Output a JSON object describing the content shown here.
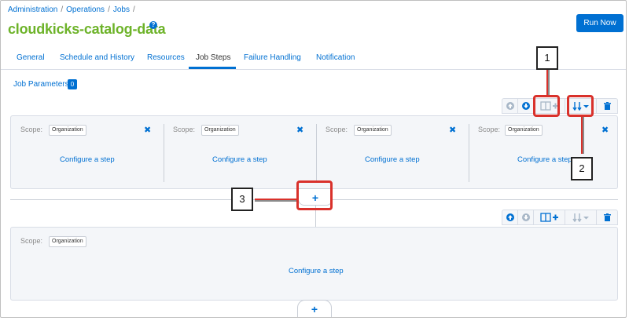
{
  "breadcrumb": [
    "Administration",
    "Operations",
    "Jobs"
  ],
  "breadcrumb_sep": "/",
  "page_title": "cloudkicks-catalog-data",
  "help_glyph": "?",
  "run_button": "Run Now",
  "tabs": [
    {
      "label": "General"
    },
    {
      "label": "Schedule and History"
    },
    {
      "label": "Resources"
    },
    {
      "label": "Job Steps",
      "active": true
    },
    {
      "label": "Failure Handling"
    },
    {
      "label": "Notification"
    }
  ],
  "job_parameters": {
    "label": "Job Parameters",
    "count": "0"
  },
  "flow1": {
    "steps": [
      {
        "scope_label": "Scope:",
        "scope_value": "Organization",
        "close": "✖",
        "configure": "Configure a step"
      },
      {
        "scope_label": "Scope:",
        "scope_value": "Organization",
        "close": "✖",
        "configure": "Configure a step"
      },
      {
        "scope_label": "Scope:",
        "scope_value": "Organization",
        "close": "✖",
        "configure": "Configure a step"
      },
      {
        "scope_label": "Scope:",
        "scope_value": "Organization",
        "close": "✖",
        "configure": "Configure a step"
      }
    ]
  },
  "flow2": {
    "steps": [
      {
        "scope_label": "Scope:",
        "scope_value": "Organization",
        "configure": "Configure a step"
      }
    ]
  },
  "add_flow_glyph": "+",
  "callouts": [
    "1",
    "2",
    "3"
  ],
  "colors": {
    "accent": "#0070d2",
    "title": "#6db329",
    "callout": "#d9312b"
  }
}
